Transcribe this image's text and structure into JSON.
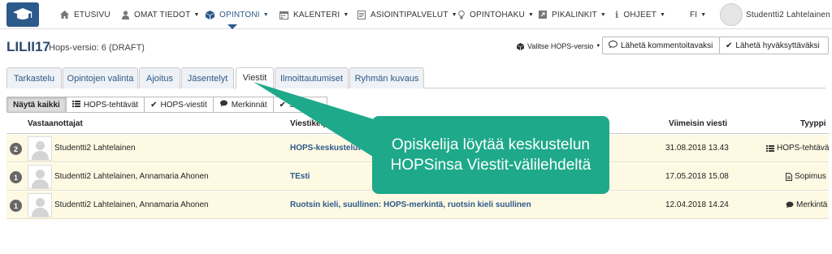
{
  "nav": {
    "items": [
      {
        "label": "ETUSIVU",
        "icon": "home-icon",
        "caret": false
      },
      {
        "label": "OMAT TIEDOT",
        "icon": "user-icon",
        "caret": true
      },
      {
        "label": "OPINTONI",
        "icon": "cube-icon",
        "caret": true,
        "active": true
      },
      {
        "label": "KALENTERI",
        "icon": "calendar-icon",
        "caret": true
      },
      {
        "label": "ASIOINTIPALVELUT",
        "icon": "file-icon",
        "caret": true
      },
      {
        "label": "OPINTOHAKU",
        "icon": "lightbulb-icon",
        "caret": true
      },
      {
        "label": "PIKALINKIT",
        "icon": "external-link-icon",
        "caret": true
      },
      {
        "label": "OHJEET",
        "icon": "info-icon",
        "caret": true
      }
    ],
    "language": "FI",
    "user_name": "Studentti2 Lahtelainen"
  },
  "header": {
    "title": "LILII17",
    "subtitle": "Hops-versio: 6 (DRAFT)",
    "version_select": "Valitse HOPS-versio",
    "comment_button": "Lähetä kommentoitavaksi",
    "approve_button": "Lähetä hyväksyttäväksi"
  },
  "tabs": [
    {
      "label": "Tarkastelu"
    },
    {
      "label": "Opintojen valinta"
    },
    {
      "label": "Ajoitus"
    },
    {
      "label": "Jäsentelyt"
    },
    {
      "label": "Viestit",
      "active": true
    },
    {
      "label": "Ilmoittautumiset"
    },
    {
      "label": "Ryhmän kuvaus"
    }
  ],
  "filters": [
    {
      "label": "Näytä kaikki",
      "icon": "",
      "active": true
    },
    {
      "label": "HOPS-tehtävät",
      "icon": "list-icon"
    },
    {
      "label": "HOPS-viestit",
      "icon": "check-icon"
    },
    {
      "label": "Merkinnät",
      "icon": "comment-icon"
    },
    {
      "label": "Sopimus",
      "icon": "check-icon"
    }
  ],
  "table": {
    "headers": {
      "recipients": "Vastaanottajat",
      "subject": "Viestiketjun aihe",
      "latest": "Viimeisin viesti",
      "type": "Tyyppi"
    },
    "rows": [
      {
        "count": "2",
        "recipients": "Studentti2 Lahtelainen",
        "subject": "HOPS-keskustelut",
        "latest": "31.08.2018 13.43",
        "type": "HOPS-tehtävä",
        "type_icon": "list-icon"
      },
      {
        "count": "1",
        "recipients": "Studentti2 Lahtelainen, Annamaria Ahonen",
        "subject": "TEsti",
        "latest": "17.05.2018 15.08",
        "type": "Sopimus",
        "type_icon": "document-icon"
      },
      {
        "count": "1",
        "recipients": "Studentti2 Lahtelainen, Annamaria Ahonen",
        "subject": "Ruotsin kieli, suullinen: HOPS-merkintä, ruotsin kieli suullinen",
        "latest": "12.04.2018 14.24",
        "type": "Merkintä",
        "type_icon": "comment-icon"
      }
    ]
  },
  "callout": {
    "line1": "Opiskelija löytää keskustelun",
    "line2": "HOPSinsa Viestit-välilehdeltä",
    "color": "#1ea98a"
  },
  "colors": {
    "brand": "#2c5a8a",
    "row_highlight": "#fdf9e3"
  }
}
